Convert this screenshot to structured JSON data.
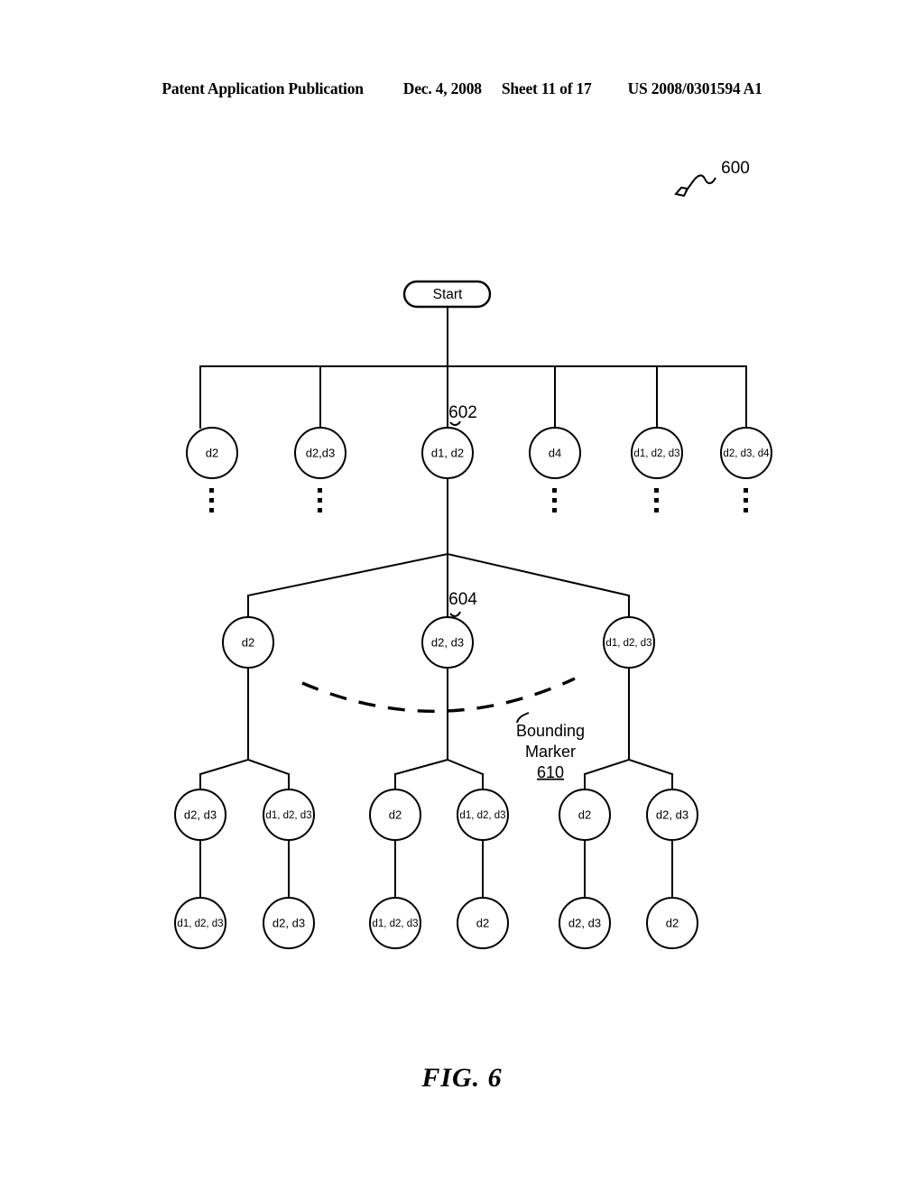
{
  "header": {
    "publication": "Patent Application Publication",
    "date": "Dec. 4, 2008",
    "sheet": "Sheet 11 of 17",
    "number": "US 2008/0301594 A1"
  },
  "figure": {
    "caption": "FIG. 6",
    "diagram_ref": "600",
    "start_label": "Start",
    "ref_602": "602",
    "ref_604": "604",
    "bounding_marker": {
      "line1": "Bounding",
      "line2": "Marker",
      "line3": "610"
    }
  },
  "tree": {
    "row1": [
      {
        "label": "d2"
      },
      {
        "label": "d2,d3"
      },
      {
        "label": "d1, d2"
      },
      {
        "label": "d4"
      },
      {
        "label": "d1, d2, d3"
      },
      {
        "label": "d2, d3, d4"
      }
    ],
    "row2": [
      {
        "label": "d2"
      },
      {
        "label": "d2, d3"
      },
      {
        "label": "d1, d2, d3"
      }
    ],
    "row3": [
      {
        "label": "d2, d3"
      },
      {
        "label": "d1, d2, d3"
      },
      {
        "label": "d2"
      },
      {
        "label": "d1, d2, d3"
      },
      {
        "label": "d2"
      },
      {
        "label": "d2, d3"
      }
    ],
    "row4": [
      {
        "label": "d1, d2, d3"
      },
      {
        "label": "d2, d3"
      },
      {
        "label": "d1, d2, d3"
      },
      {
        "label": "d2"
      },
      {
        "label": "d2, d3"
      },
      {
        "label": "d2"
      }
    ]
  }
}
